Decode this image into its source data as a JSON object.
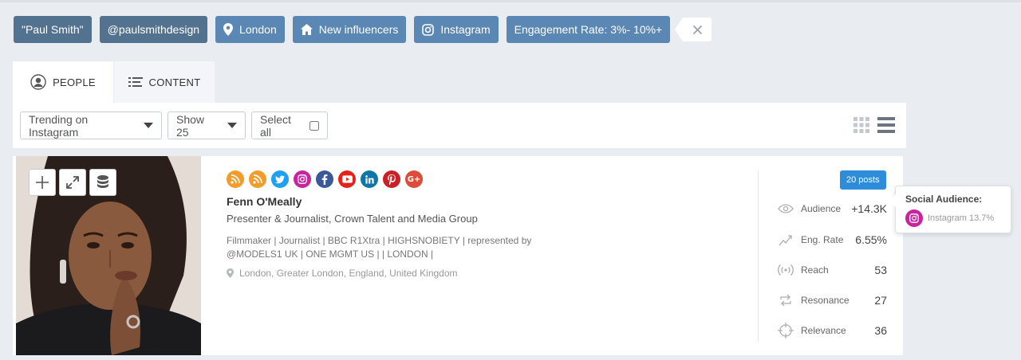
{
  "filters": {
    "query": "\"Paul Smith\"",
    "handle": "@paulsmithdesign",
    "location": "London",
    "segment": "New influencers",
    "platform": "Instagram",
    "engagement": "Engagement Rate: 3%- 10%+"
  },
  "tabs": {
    "people": "PEOPLE",
    "content": "CONTENT"
  },
  "toolbar": {
    "sort_value": "Trending on Instagram",
    "show_value": "Show 25",
    "select_all": "Select all"
  },
  "profile": {
    "name": "Fenn O'Meally",
    "title": "Presenter & Journalist, Crown Talent and Media Group",
    "bio": "Filmmaker | Journalist | BBC R1Xtra | HIGHSNOBIETY | represented by @MODELS1 UK | ONE MGMT US | | LONDON |",
    "location": "London, Greater London, England, United Kingdom",
    "posts_badge": "20 posts",
    "social_icons": [
      "rss-icon",
      "rss-icon",
      "twitter-icon",
      "instagram-icon",
      "facebook-icon",
      "youtube-icon",
      "linkedin-icon",
      "pinterest-icon",
      "google-plus-icon"
    ],
    "social_colors": [
      "#f39c2a",
      "#f39c2a",
      "#1da1f2",
      "#c8249d",
      "#3b5998",
      "#e62117",
      "#0e76a8",
      "#cb2027",
      "#dd4b39"
    ]
  },
  "metrics": {
    "audience_label": "Audience",
    "audience_value": "+14.3K",
    "eng_label": "Eng. Rate",
    "eng_value": "6.55%",
    "reach_label": "Reach",
    "reach_value": "53",
    "resonance_label": "Resonance",
    "resonance_value": "27",
    "relevance_label": "Relevance",
    "relevance_value": "36"
  },
  "tooltip": {
    "title": "Social Audience:",
    "row": "Instagram 13.7%"
  },
  "colors": {
    "chip": "#5a87b3",
    "chip_dark": "#52728f",
    "badge": "#2e8ddb"
  }
}
